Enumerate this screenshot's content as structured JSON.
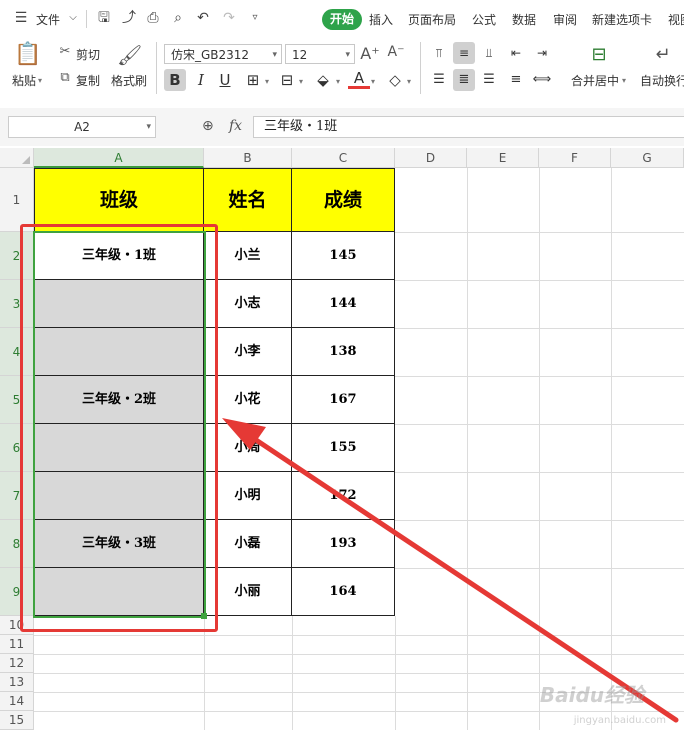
{
  "menu": {
    "file_label": "文件",
    "tabs": [
      "开始",
      "插入",
      "页面布局",
      "公式",
      "数据",
      "审阅",
      "新建选项卡",
      "视图"
    ],
    "active_tab": "开始"
  },
  "toolbar": {
    "paste_label": "粘贴",
    "cut_label": "剪切",
    "copy_label": "复制",
    "format_painter_label": "格式刷",
    "font_name": "仿宋_GB2312",
    "font_size": "12",
    "merge_center_label": "合并居中",
    "wrap_text_label": "自动换行",
    "bold_label": "B",
    "italic_label": "I",
    "underline_label": "U"
  },
  "formula_bar": {
    "name_box": "A2",
    "fx_label": "fx",
    "formula_value": "三年级・1班"
  },
  "sheet": {
    "columns": [
      "A",
      "B",
      "C",
      "D",
      "E",
      "F",
      "G"
    ],
    "selected_column": "A",
    "rows": [
      "1",
      "2",
      "3",
      "4",
      "5",
      "6",
      "7",
      "8",
      "9",
      "10",
      "11",
      "12",
      "13",
      "14",
      "15"
    ],
    "header": {
      "class": "班级",
      "name": "姓名",
      "score": "成绩"
    },
    "class_groups": [
      "三年级・1班",
      "三年级・2班",
      "三年级・3班"
    ],
    "names": [
      "小兰",
      "小志",
      "小李",
      "小花",
      "小周",
      "小明",
      "小磊",
      "小丽"
    ],
    "scores": [
      "145",
      "144",
      "138",
      "167",
      "155",
      "172",
      "193",
      "164"
    ],
    "colors": {
      "header_fill": "#ffff00",
      "selection": "#3fa33f",
      "annotation": "#e53935",
      "merged_fill": "#d8d8d8"
    }
  },
  "watermark": {
    "text": "Baidu经验",
    "sub": "jingyan.baidu.com"
  }
}
